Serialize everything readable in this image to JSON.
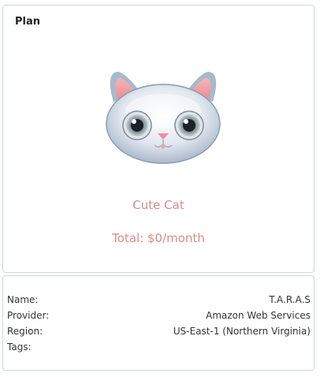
{
  "plan": {
    "title": "Plan",
    "name": "Cute Cat",
    "total": "Total: $0/month",
    "image_icon": "cat-face-icon"
  },
  "details": {
    "name_label": "Name:",
    "name_value": "T.A.R.A.S",
    "provider_label": "Provider:",
    "provider_value": "Amazon Web Services",
    "region_label": "Region:",
    "region_value": "US-East-1 (Northern Virginia)",
    "tags_label": "Tags:",
    "tags_value": ""
  },
  "colors": {
    "accent_text": "#d68d88",
    "border": "#cfd6de"
  }
}
